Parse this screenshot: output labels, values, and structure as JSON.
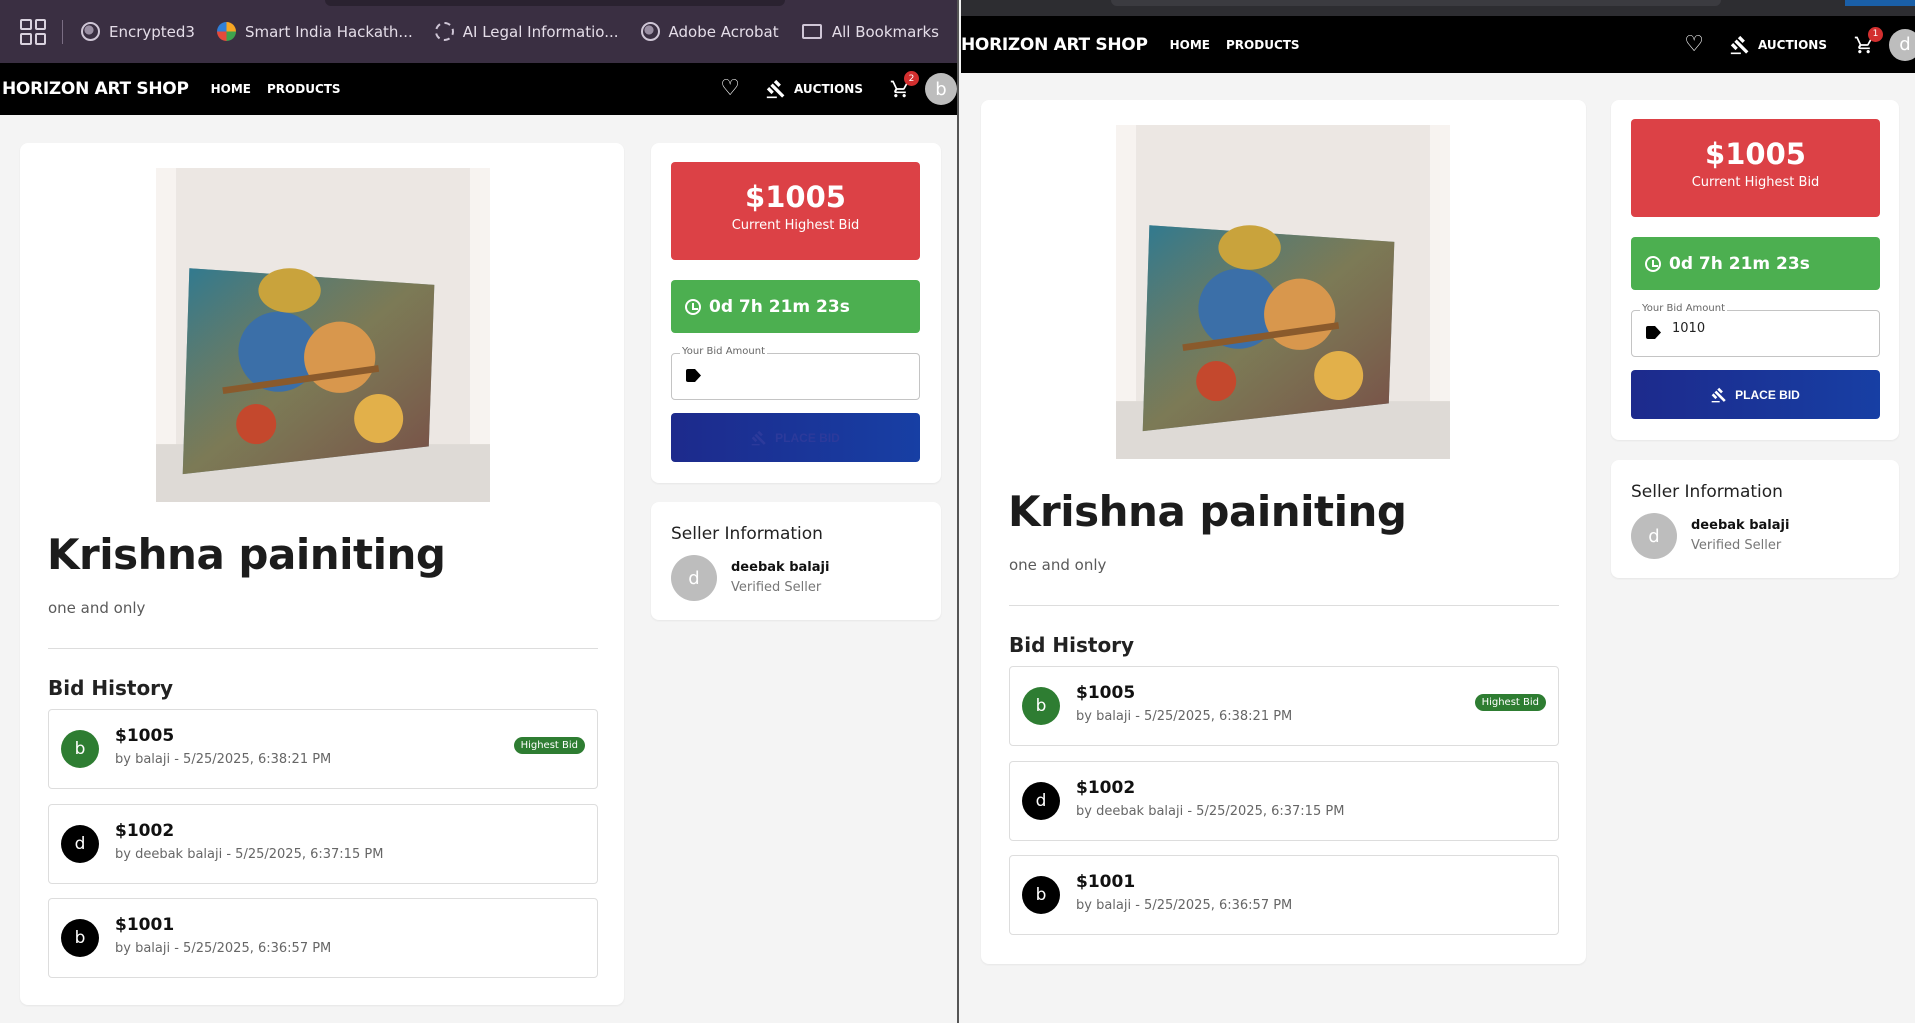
{
  "bookmarks": [
    {
      "label": "Encrypted3",
      "icon": "globe-icon"
    },
    {
      "label": "Smart India Hackath...",
      "icon": "sih-icon"
    },
    {
      "label": "AI Legal Informatio...",
      "icon": "ai-icon"
    },
    {
      "label": "Adobe Acrobat",
      "icon": "globe-icon"
    }
  ],
  "all_bookmarks": "All Bookmarks",
  "header": {
    "brand": "HORIZON ART SHOP",
    "home": "HOME",
    "products": "PRODUCTS",
    "auctions": "AUCTIONS"
  },
  "left": {
    "cart_count": "2",
    "user_initial": "b"
  },
  "right": {
    "cart_count": "1",
    "user_initial": "d"
  },
  "product": {
    "title": "Krishna painiting",
    "description": "one and only"
  },
  "bid_history": {
    "heading": "Bid History",
    "highest_label": "Highest Bid",
    "items": [
      {
        "initial": "b",
        "amount": "$1005",
        "meta": "by balaji - 5/25/2025, 6:38:21 PM",
        "highest": true,
        "avatar_color": "#2e7d32"
      },
      {
        "initial": "d",
        "amount": "$1002",
        "meta": "by deebak balaji - 5/25/2025, 6:37:15 PM",
        "highest": false,
        "avatar_color": "#000000"
      },
      {
        "initial": "b",
        "amount": "$1001",
        "meta": "by balaji - 5/25/2025, 6:36:57 PM",
        "highest": false,
        "avatar_color": "#000000"
      }
    ]
  },
  "auction": {
    "current_bid": "$1005",
    "current_bid_label": "Current Highest Bid",
    "time_left": "0d 7h 21m 23s",
    "bid_label": "Your Bid Amount",
    "left_bid_value": "",
    "right_bid_value": "1010",
    "place_bid": "PLACE BID"
  },
  "seller": {
    "heading": "Seller Information",
    "initial": "d",
    "name": "deebak balaji",
    "status": "Verified Seller"
  },
  "colors": {
    "price_red": "#dc4146",
    "timer_green": "#4caf50",
    "button_blue": "#1d2a8c",
    "highest_green": "#2e7d32"
  }
}
